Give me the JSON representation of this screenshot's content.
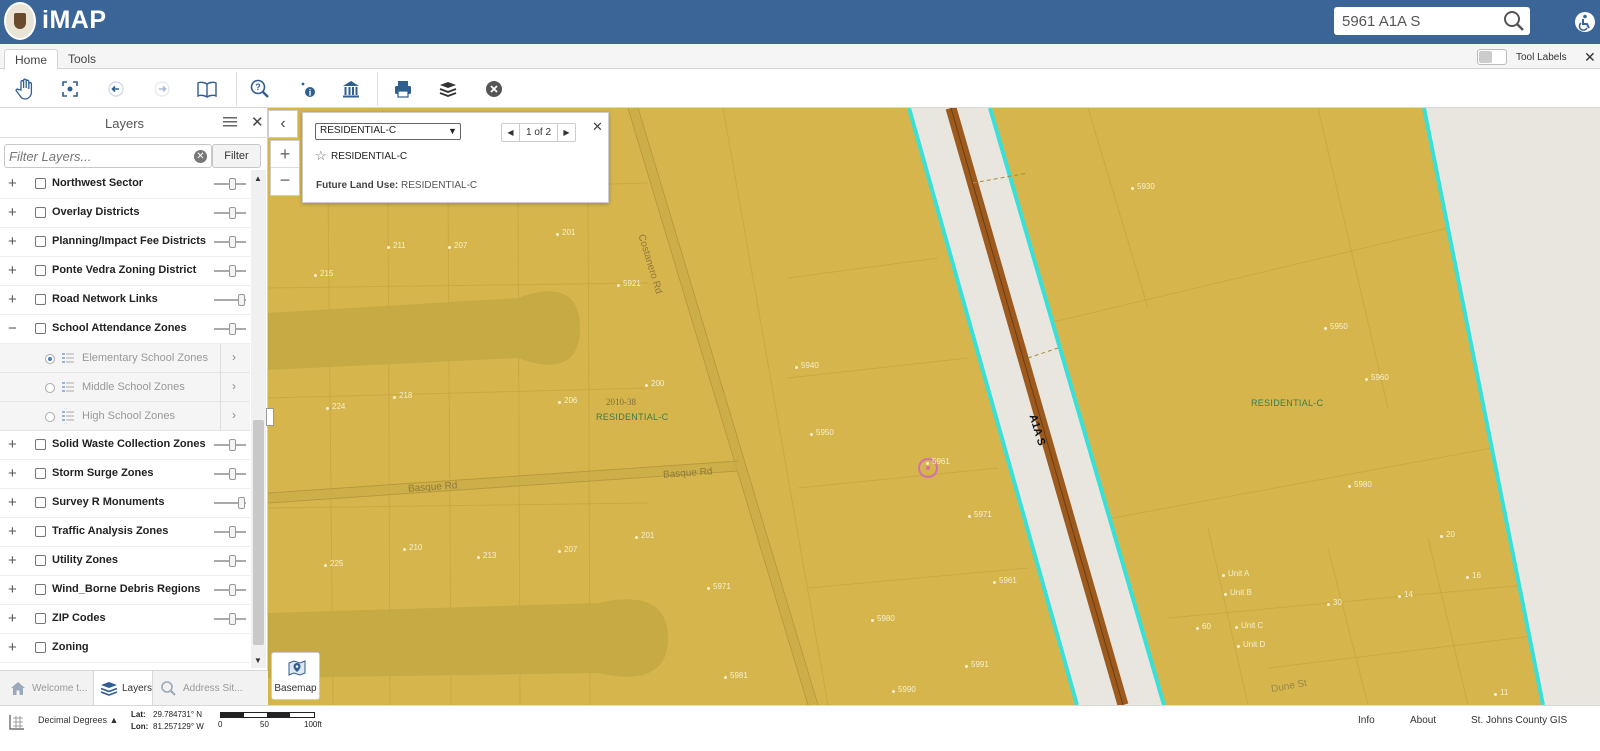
{
  "header": {
    "app_title": "iMAP",
    "search_value": "5961 A1A S",
    "brand_color": "#3a6596"
  },
  "tabs": {
    "home": "Home",
    "tools": "Tools",
    "tool_labels": "Tool Labels",
    "close": "✕"
  },
  "toolbar": {
    "icons": [
      "pan-hand-icon",
      "full-extent-icon",
      "previous-extent-icon",
      "next-extent-icon",
      "bookmarks-book-icon",
      "identify-search-icon",
      "info-point-icon",
      "parcel-building-icon",
      "print-icon",
      "layers-stack-icon",
      "clear-x-icon"
    ]
  },
  "layers_panel": {
    "title": "Layers",
    "close": "✕",
    "filter_placeholder": "Filter Layers...",
    "filter_clear": "✕",
    "filter_button": "Filter",
    "layers": [
      {
        "label": "Northwest Sector",
        "expander": "+"
      },
      {
        "label": "Overlay Districts",
        "expander": "+"
      },
      {
        "label": "Planning/Impact Fee Districts",
        "expander": "+"
      },
      {
        "label": "Ponte Vedra Zoning District",
        "expander": "+"
      },
      {
        "label": "Road Network Links",
        "expander": "+"
      },
      {
        "label": "School Attendance Zones",
        "expander": "−"
      },
      {
        "label": "Solid Waste Collection Zones",
        "expander": "+"
      },
      {
        "label": "Storm Surge Zones",
        "expander": "+"
      },
      {
        "label": "Survey R Monuments",
        "expander": "+"
      },
      {
        "label": "Traffic Analysis Zones",
        "expander": "+"
      },
      {
        "label": "Utility Zones",
        "expander": "+"
      },
      {
        "label": "Wind_Borne Debris Regions",
        "expander": "+"
      },
      {
        "label": "ZIP Codes",
        "expander": "+"
      },
      {
        "label": "Zoning",
        "expander": "+"
      }
    ],
    "sublayers": [
      {
        "label": "Elementary School Zones",
        "selected": true
      },
      {
        "label": "Middle School Zones",
        "selected": false
      },
      {
        "label": "High School Zones",
        "selected": false
      }
    ],
    "bottom_tabs": {
      "welcome": "Welcome t...",
      "layers": "Layers",
      "address": "Address Sit..."
    }
  },
  "popup": {
    "selected": "RESIDENTIAL-C",
    "pager": "1 of 2",
    "title": "RESIDENTIAL-C",
    "field_label": "Future Land Use:",
    "field_value": "RESIDENTIAL-C"
  },
  "map": {
    "zone_color": "#d6b64c",
    "zone_labels": [
      "RESIDENTIAL-C",
      "RESIDENTIAL-C"
    ],
    "plat_label": "2010-38",
    "streets": [
      "Costanero Rd",
      "Basque Rd",
      "Basque Rd",
      "A1A S",
      "Dune St"
    ],
    "addresses": [
      "5930",
      "201",
      "211",
      "207",
      "215",
      "5921",
      "5950",
      "200",
      "5940",
      "224",
      "218",
      "206",
      "5960",
      "5950",
      "5961",
      "5980",
      "5971",
      "210",
      "201",
      "225",
      "213",
      "207",
      "5971",
      "20",
      "5961",
      "Unit A",
      "Unit B",
      "16",
      "14",
      "30",
      "5980",
      "60",
      "Unit C",
      "Unit D",
      "5981",
      "5991",
      "5990",
      "11"
    ],
    "basemap_label": "Basemap"
  },
  "status": {
    "coord_mode": "Decimal Degrees ▲",
    "lat_label": "Lat:",
    "lat_value": "29.784731° N",
    "lon_label": "Lon:",
    "lon_value": "81.257129° W",
    "scale_labels": [
      "0",
      "50",
      "100ft"
    ],
    "links": [
      "Info",
      "About",
      "St. Johns County GIS"
    ]
  }
}
